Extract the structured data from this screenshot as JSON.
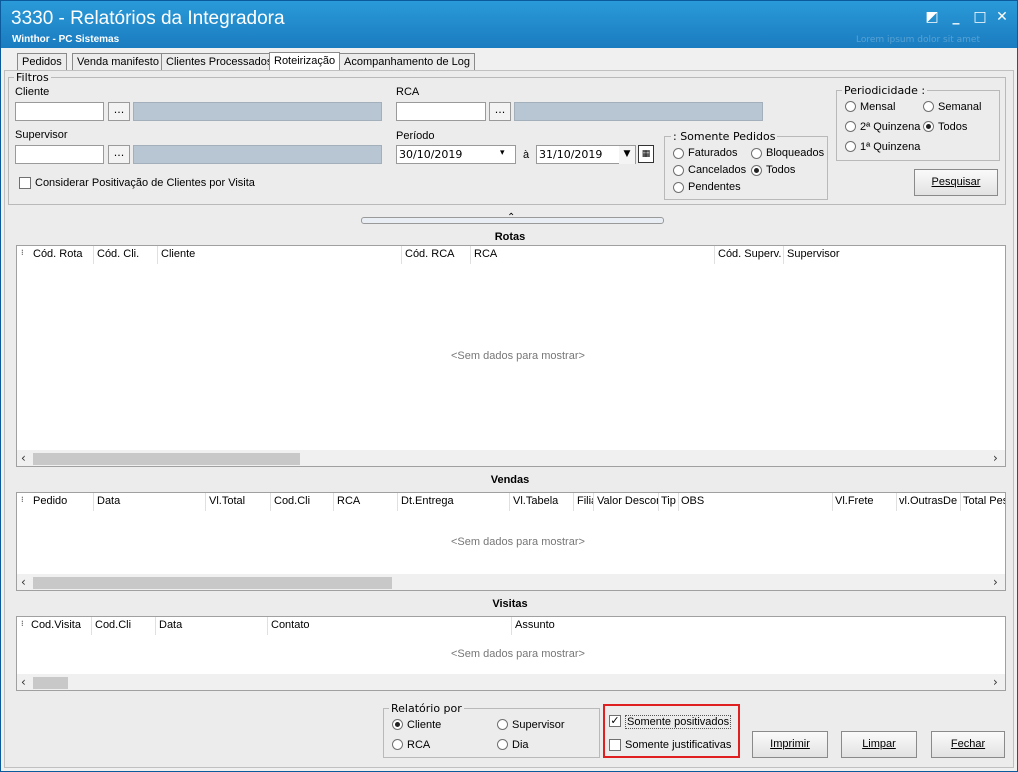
{
  "window": {
    "title": "3330 - Relatórios da Integradora",
    "subtitle": "Winthor - PC Sistemas",
    "faded_text": "Lorem ipsum dolor sit amet"
  },
  "tabs": [
    {
      "label": "Pedidos",
      "active": false
    },
    {
      "label": "Venda manifesto",
      "active": false
    },
    {
      "label": "Clientes Processados",
      "active": false
    },
    {
      "label": "Roteirização",
      "active": true
    },
    {
      "label": "Acompanhamento de Log",
      "active": false
    }
  ],
  "filtros": {
    "legend": "Filtros",
    "cliente_label": "Cliente",
    "cliente_value": "",
    "rca_label": "RCA",
    "rca_value": "",
    "supervisor_label": "Supervisor",
    "supervisor_value": "",
    "dots": "...",
    "periodo_label": "Período",
    "date_from": "30/10/2019",
    "date_sep": "à",
    "date_to": "31/10/2019",
    "considerar_label": "Considerar Positivação de Clientes por Visita",
    "considerar_checked": false
  },
  "somente_pedidos": {
    "legend": ": Somente Pedidos",
    "options": [
      "Faturados",
      "Bloqueados",
      "Cancelados",
      "Todos",
      "Pendentes"
    ],
    "selected": "Todos"
  },
  "periodicidade": {
    "legend": "Periodicidade :",
    "options": [
      "Mensal",
      "Semanal",
      "2ª Quinzena",
      "Todos",
      "1ª Quinzena"
    ],
    "selected": "Todos"
  },
  "buttons": {
    "pesquisar": "Pesquisar",
    "imprimir": "Imprimir",
    "limpar": "Limpar",
    "fechar": "Fechar"
  },
  "rotas": {
    "title": "Rotas",
    "columns": [
      "Cód. Rota",
      "Cód. Cli.",
      "Cliente",
      "Cód. RCA",
      "RCA",
      "Cód. Superv.",
      "Supervisor"
    ],
    "empty": "<Sem dados para mostrar>"
  },
  "vendas": {
    "title": "Vendas",
    "columns": [
      "Pedido",
      "Data",
      "Vl.Total",
      "Cod.Cli",
      "RCA",
      "Dt.Entrega",
      "Vl.Tabela",
      "Filia",
      "Valor Descor",
      "Tip",
      "OBS",
      "Vl.Frete",
      "vl.OutrasDe",
      "Total Pes"
    ],
    "empty": "<Sem dados para mostrar>"
  },
  "visitas": {
    "title": "Visitas",
    "columns": [
      "Cod.Visita",
      "Cod.Cli",
      "Data",
      "Contato",
      "Assunto"
    ],
    "empty": "<Sem dados para mostrar>"
  },
  "relatorio_por": {
    "legend": "Relatório por",
    "options": [
      "Cliente",
      "Supervisor",
      "RCA",
      "Dia"
    ],
    "selected": "Cliente"
  },
  "somente_positivados": {
    "label": "Somente positivados",
    "checked": true
  },
  "somente_justificativas": {
    "label": "Somente justificativas",
    "checked": false
  }
}
